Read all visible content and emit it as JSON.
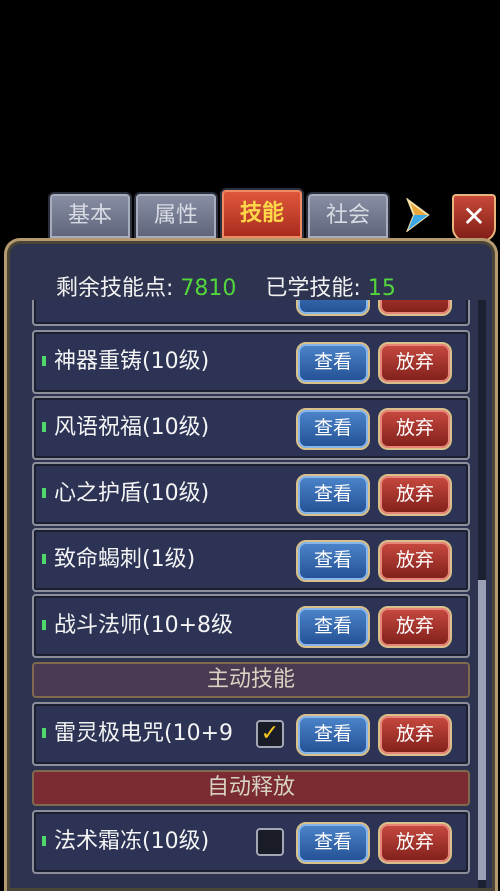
{
  "tabs": [
    {
      "label": "基本",
      "active": false
    },
    {
      "label": "属性",
      "active": false
    },
    {
      "label": "技能",
      "active": true
    },
    {
      "label": "社会",
      "active": false
    }
  ],
  "close_label": "✕",
  "header": {
    "points_label": "剩余技能点:",
    "points_value": "7810",
    "learned_label": "已学技能:",
    "learned_value": "15"
  },
  "buttons": {
    "view": "查看",
    "drop": "放弃"
  },
  "skills": [
    {
      "name": "神器重铸(10级)"
    },
    {
      "name": "风语祝福(10级)"
    },
    {
      "name": "心之护盾(10级)"
    },
    {
      "name": "致命蝎刺(1级)"
    },
    {
      "name": "战斗法师(10+8级"
    }
  ],
  "active_section": {
    "title": "主动技能",
    "skill": {
      "name": "雷灵极电咒(10+9",
      "checked": true
    }
  },
  "auto_section": {
    "title": "自动释放",
    "skill": {
      "name": "法术霜冻(10级)",
      "checked": false
    }
  },
  "colors": {
    "accent_green": "#53d63b",
    "tab_active_text": "#ffd84a"
  }
}
